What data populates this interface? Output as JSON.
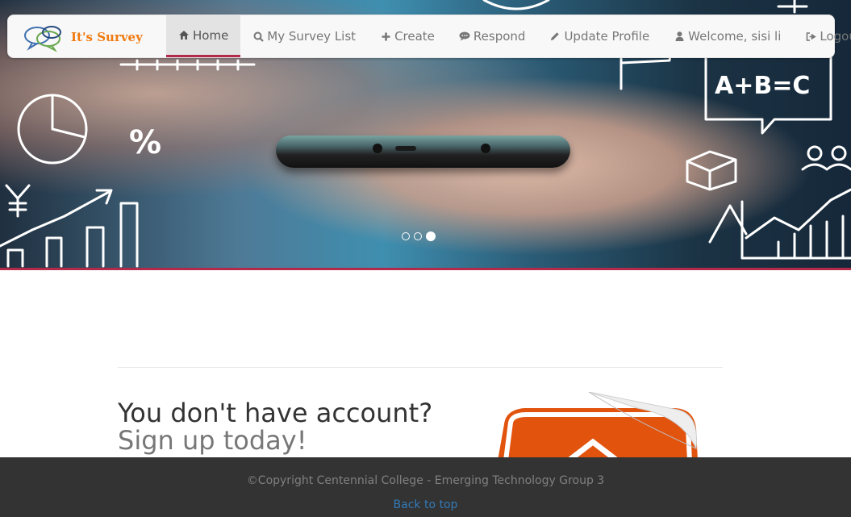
{
  "brand": {
    "name": "It's Survey"
  },
  "nav": {
    "items": [
      {
        "label": "Home",
        "icon": "home-icon",
        "active": true
      },
      {
        "label": "My Survey List",
        "icon": "search-icon"
      },
      {
        "label": "Create",
        "icon": "plus-icon"
      },
      {
        "label": "Respond",
        "icon": "comment-icon"
      },
      {
        "label": "Update Profile",
        "icon": "pencil-icon"
      },
      {
        "label": "Welcome, sisi li",
        "icon": "user-icon"
      },
      {
        "label": "Logout",
        "icon": "logout-icon"
      }
    ]
  },
  "carousel": {
    "slide_count": 3,
    "active_index": 2
  },
  "hero_doodle_text": {
    "equation": "A+B=C",
    "percent": "%"
  },
  "signup": {
    "heading": "You don't have account?",
    "subheading": "Sign up today!"
  },
  "footer": {
    "copyright": "©Copyright Centennial College - Emerging Technology Group 3",
    "back_to_top": "Back to top"
  },
  "colors": {
    "accent": "#b3294a",
    "brand_orange": "#ef7a10",
    "footer_bg": "#333333",
    "link": "#337ab7"
  }
}
